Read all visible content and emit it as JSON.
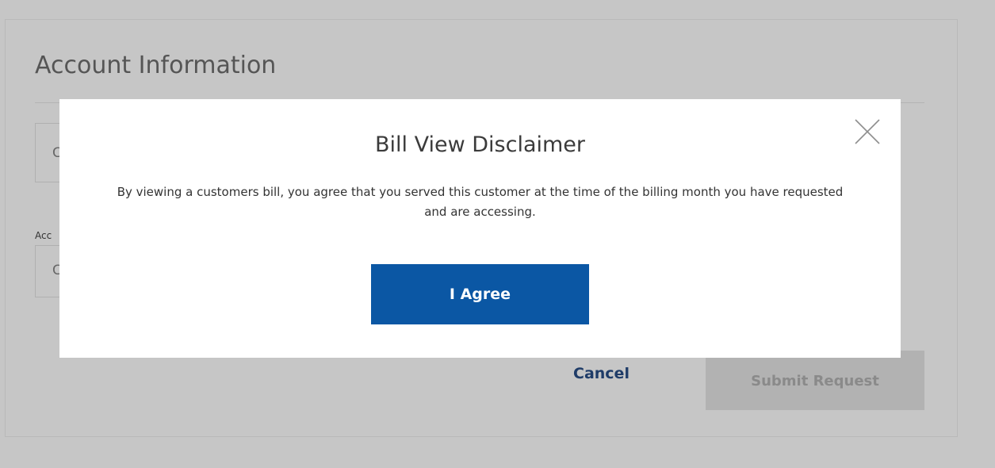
{
  "page": {
    "section_title": "Account Information",
    "field1_value_partial": "C",
    "field2_label_partial": "Acc",
    "field2_value_partial": "C",
    "cancel_label": "Cancel",
    "submit_label": "Submit Request"
  },
  "modal": {
    "title": "Bill View Disclaimer",
    "body": "By viewing a customers bill, you agree that you served this customer at the time of the billing month you have requested and are accessing.",
    "agree_label": "I Agree",
    "close_icon": "close-icon"
  },
  "colors": {
    "overlay": "#c6c6c6",
    "primary": "#0b57a4",
    "link": "#1f3c68",
    "disabled_button": "#b2b2b2"
  }
}
